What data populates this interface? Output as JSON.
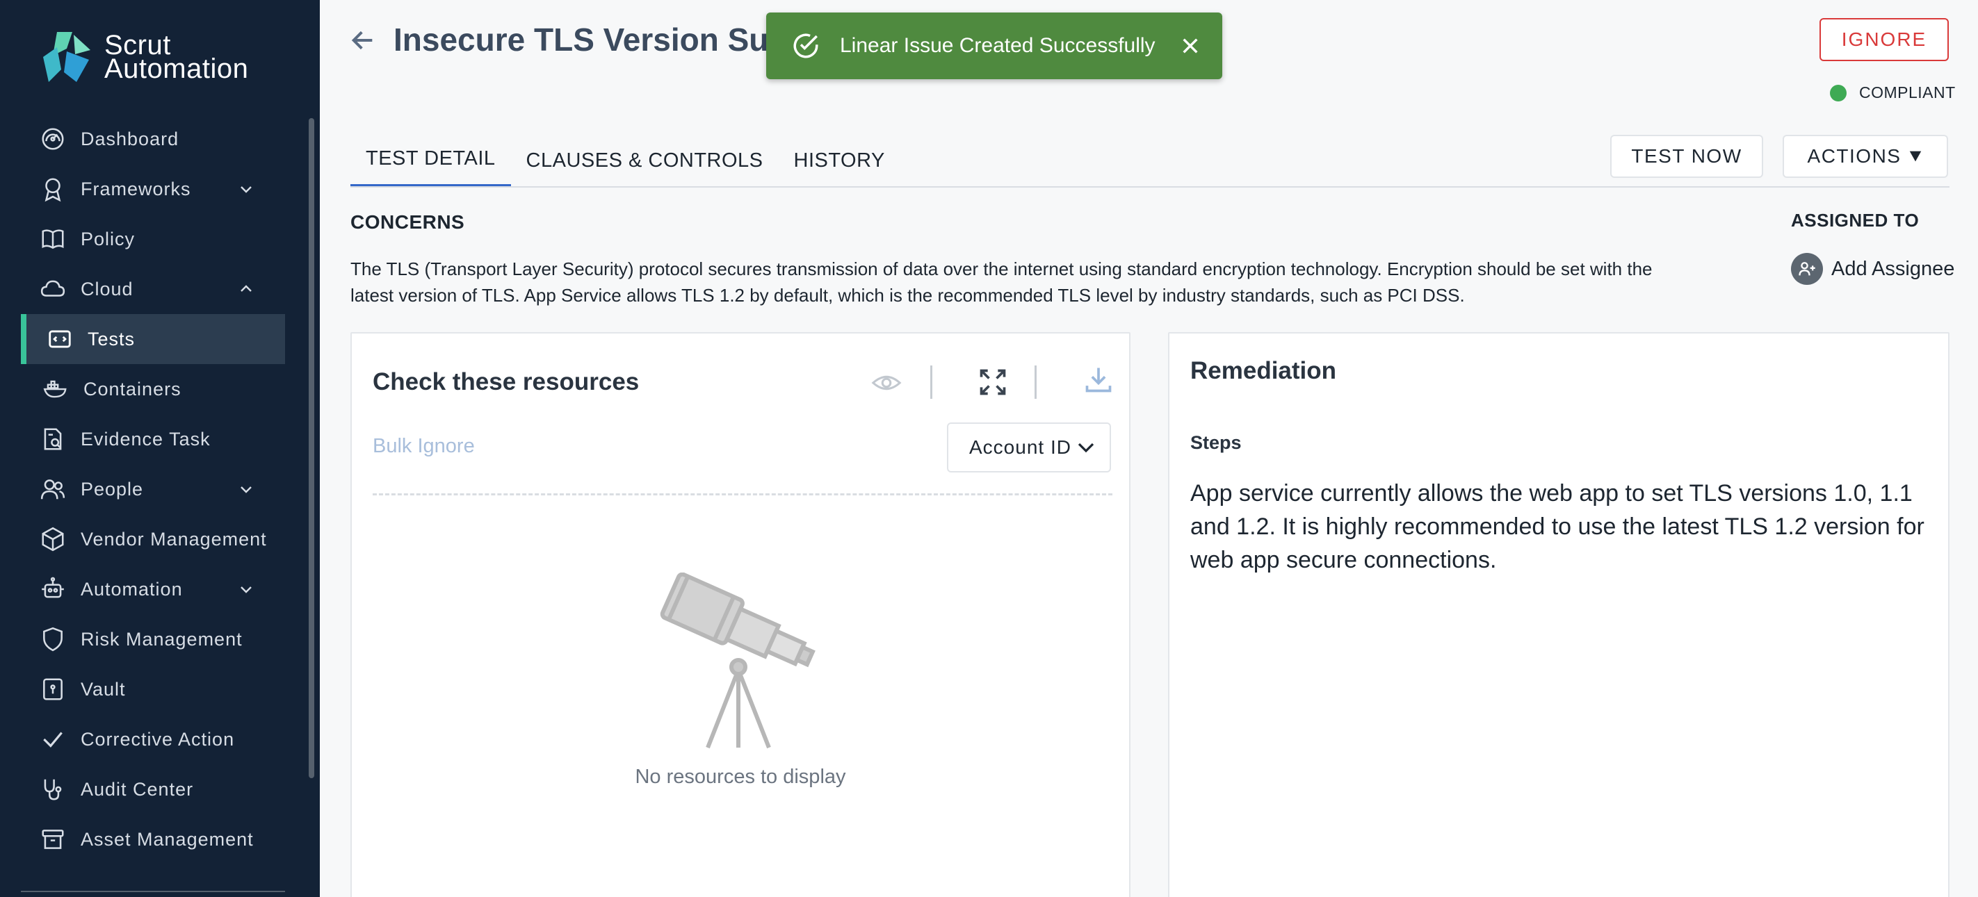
{
  "brand": {
    "line1": "Scrut",
    "line2": "Automation"
  },
  "sidebar": {
    "items": [
      {
        "label": "Dashboard",
        "icon": "dashboard-icon"
      },
      {
        "label": "Frameworks",
        "icon": "frameworks-icon",
        "expandable": true
      },
      {
        "label": "Policy",
        "icon": "policy-icon"
      },
      {
        "label": "Cloud",
        "icon": "cloud-icon",
        "expanded": true
      },
      {
        "label": "Tests",
        "icon": "tests-icon",
        "active": true
      },
      {
        "label": "Containers",
        "icon": "containers-icon"
      },
      {
        "label": "Evidence Task",
        "icon": "evidence-icon"
      },
      {
        "label": "People",
        "icon": "people-icon",
        "expandable": true
      },
      {
        "label": "Vendor Management",
        "icon": "vendor-icon"
      },
      {
        "label": "Automation",
        "icon": "automation-icon",
        "expandable": true
      },
      {
        "label": "Risk Management",
        "icon": "shield-icon"
      },
      {
        "label": "Vault",
        "icon": "vault-icon"
      },
      {
        "label": "Corrective Action",
        "icon": "check-icon"
      },
      {
        "label": "Audit Center",
        "icon": "stethoscope-icon"
      },
      {
        "label": "Asset Management",
        "icon": "archive-icon"
      }
    ]
  },
  "header": {
    "title": "Insecure TLS Version Suppo",
    "ignore_label": "IGNORE",
    "status_label": "COMPLIANT",
    "status_color": "#3eaa54"
  },
  "toast": {
    "message": "Linear Issue Created Successfully",
    "color": "#4f8a3f"
  },
  "tabs": [
    {
      "label": "TEST DETAIL",
      "active": true
    },
    {
      "label": "CLAUSES & CONTROLS"
    },
    {
      "label": "HISTORY"
    }
  ],
  "toolbar": {
    "test_now_label": "TEST NOW",
    "actions_label": "ACTIONS"
  },
  "concerns": {
    "heading": "CONCERNS",
    "text": "The TLS (Transport Layer Security) protocol secures transmission of data over the internet using standard encryption technology. Encryption should be set with the latest version of TLS. App Service allows TLS 1.2 by default, which is the recommended TLS level by industry standards, such as PCI DSS."
  },
  "assignment": {
    "heading": "ASSIGNED TO",
    "add_label": "Add Assignee"
  },
  "resources": {
    "heading": "Check these resources",
    "bulk_ignore_label": "Bulk Ignore",
    "select_value": "Account ID",
    "empty_message": "No resources to display"
  },
  "remediation": {
    "heading": "Remediation",
    "steps_heading": "Steps",
    "steps_text": "App service currently allows the web app to set TLS versions 1.0, 1.1 and 1.2. It is highly recommended to use the latest TLS 1.2 version for web app secure connections."
  }
}
